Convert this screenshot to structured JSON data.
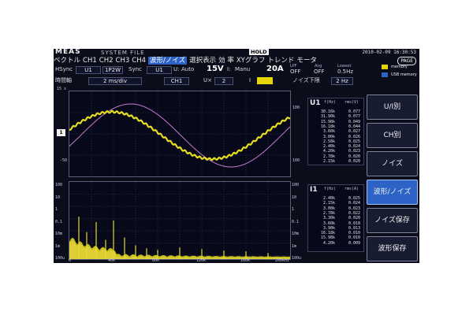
{
  "header": {
    "logo": "MEAS",
    "system_file": "SYSTEM  FILE",
    "hold": "HOLD",
    "datetime": "2010-02-09  16:30:53"
  },
  "tabs": [
    {
      "label": "ベクトル",
      "active": false
    },
    {
      "label": "CH1",
      "active": false
    },
    {
      "label": "CH2",
      "active": false
    },
    {
      "label": "CH3",
      "active": false
    },
    {
      "label": "CH4",
      "active": false
    },
    {
      "label": "波形/ノイズ",
      "active": true
    },
    {
      "label": "選択表示",
      "active": false
    },
    {
      "label": "効  率",
      "active": false
    },
    {
      "label": "XYグラフ",
      "active": false
    },
    {
      "label": "トレンド",
      "active": false
    },
    {
      "label": "モータ",
      "active": false
    }
  ],
  "page_button": "PAGE",
  "memory": {
    "item1": "memory",
    "item2": "USB  memory"
  },
  "settings": {
    "hsync_label": "HSync",
    "hsync_value": "U1",
    "wiring_value": "1P2W",
    "sync_label": "Sync",
    "sync_value": "U1",
    "u_label": "U:",
    "u_mode": "Auto",
    "u_range": "15V",
    "i_label": "I:",
    "i_mode": "Manu",
    "i_range": "20A",
    "lpf_label": "LPF",
    "lpf_value": "OFF",
    "avg_label": "Avg",
    "avg_value": "OFF",
    "lowest_label": "Lowest",
    "lowest_value": "0.5Hz",
    "time_axis_label": "時間軸",
    "time_axis_value": "2 ms/div",
    "ch_value": "CH1",
    "u_zoom_label": "U×",
    "u_zoom_value": "2",
    "i_zoom_label": "I",
    "noise_label": "ノイズ下限",
    "noise_value": "2 Hz"
  },
  "waveform": {
    "u_scale_top": "15 s",
    "u_scale_zero": "0",
    "u_scale_bot": "-50",
    "i_scale_top": "100",
    "i_scale_bot": "100",
    "marker": "1"
  },
  "spectrum": {
    "y_labels": [
      "100",
      "10",
      "1",
      "0.1",
      "10m",
      "1m",
      "100u"
    ],
    "y_labels_right": [
      "100",
      "10",
      "1",
      "0.1",
      "10m",
      "1m",
      "100u"
    ],
    "x_labels": [
      "0",
      "40k",
      "80k",
      "120k",
      "160k",
      "200kHz"
    ]
  },
  "u1_table": {
    "title": "U1",
    "col_f": "f(Hz)",
    "col_rms": "rms(V)",
    "rows": [
      [
        "30.16k",
        "0.077"
      ],
      [
        "31.90k",
        "0.077"
      ],
      [
        "15.98k",
        "0.049"
      ],
      [
        "16.18k",
        "0.044"
      ],
      [
        "3.60k",
        "0.027"
      ],
      [
        "3.00k",
        "0.026"
      ],
      [
        "2.58k",
        "0.025"
      ],
      [
        "2.40k",
        "0.024"
      ],
      [
        "4.20k",
        "0.023"
      ],
      [
        "2.78k",
        "0.020"
      ],
      [
        "2.15k",
        "0.020"
      ]
    ]
  },
  "i1_table": {
    "title": "I1",
    "col_f": "f(Hz)",
    "col_rms": "rms(A)",
    "rows": [
      [
        "2.40k",
        "0.025"
      ],
      [
        "2.15k",
        "0.024"
      ],
      [
        "3.00k",
        "0.023"
      ],
      [
        "2.78k",
        "0.022"
      ],
      [
        "3.30k",
        "0.020"
      ],
      [
        "3.60k",
        "0.018"
      ],
      [
        "3.90k",
        "0.013"
      ],
      [
        "16.18k",
        "0.010"
      ],
      [
        "15.98k",
        "0.010"
      ],
      [
        "4.20k",
        "0.009"
      ]
    ]
  },
  "side_menu": [
    {
      "id": "ui",
      "label": "U/I別",
      "active": false
    },
    {
      "id": "ch",
      "label": "CH別",
      "active": false
    },
    {
      "id": "noise",
      "label": "ノイズ",
      "active": false
    },
    {
      "id": "waveform-noise",
      "label": "波形/ノイズ",
      "active": true
    },
    {
      "id": "noise-save",
      "label": "ノイズ保存",
      "active": false
    },
    {
      "id": "waveform-save",
      "label": "波形保存",
      "active": false
    }
  ],
  "colors": {
    "voltage": "#e6de1e",
    "current": "#c87ad0",
    "accent": "#2d63c7"
  }
}
